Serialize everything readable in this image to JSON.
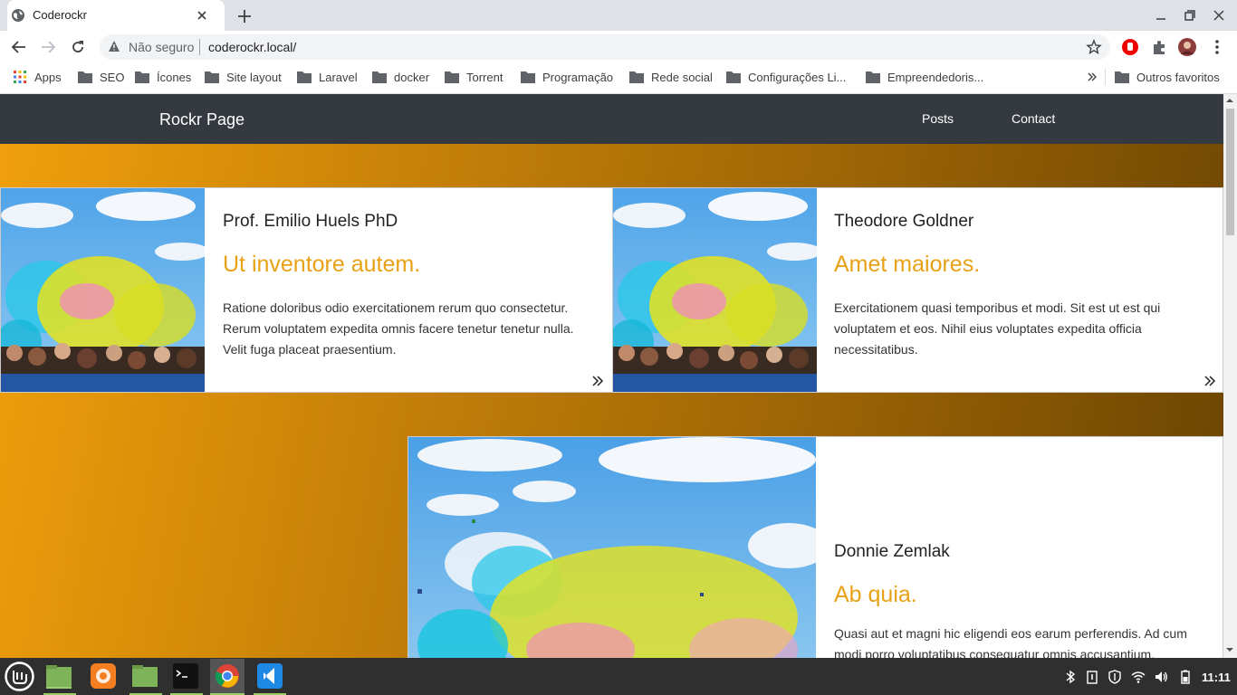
{
  "browser": {
    "tab_title": "Coderockr",
    "security_label": "Não seguro",
    "url": "coderockr.local/",
    "bookmarks": [
      "Apps",
      "SEO",
      "Ícones",
      "Site layout",
      "Laravel",
      "docker",
      "Torrent",
      "Programação",
      "Rede social",
      "Configurações Li...",
      "Empreendedoris..."
    ],
    "other_bookmarks": "Outros favoritos"
  },
  "site": {
    "brand": "Rockr Page",
    "nav": [
      "Posts",
      "Contact"
    ]
  },
  "posts": [
    {
      "author": "Prof. Emilio Huels PhD",
      "title": "Ut inventore autem.",
      "text": "Ratione doloribus odio exercitationem rerum quo consectetur. Rerum voluptatem expedita omnis facere tenetur tenetur nulla. Velit fuga placeat praesentium."
    },
    {
      "author": "Theodore Goldner",
      "title": "Amet maiores.",
      "text": "Exercitationem quasi temporibus et modi. Sit est ut est qui voluptatem et eos. Nihil eius voluptates expedita officia necessitatibus."
    },
    {
      "author": "Donnie Zemlak",
      "title": "Ab quia.",
      "text": "Quasi aut et magni hic eligendi eos earum perferendis. Ad cum modi porro voluptatibus consequatur omnis accusantium."
    }
  ],
  "taskbar": {
    "clock": "11:11"
  },
  "colors": {
    "accent": "#e8a115",
    "navbar": "#343a40"
  }
}
